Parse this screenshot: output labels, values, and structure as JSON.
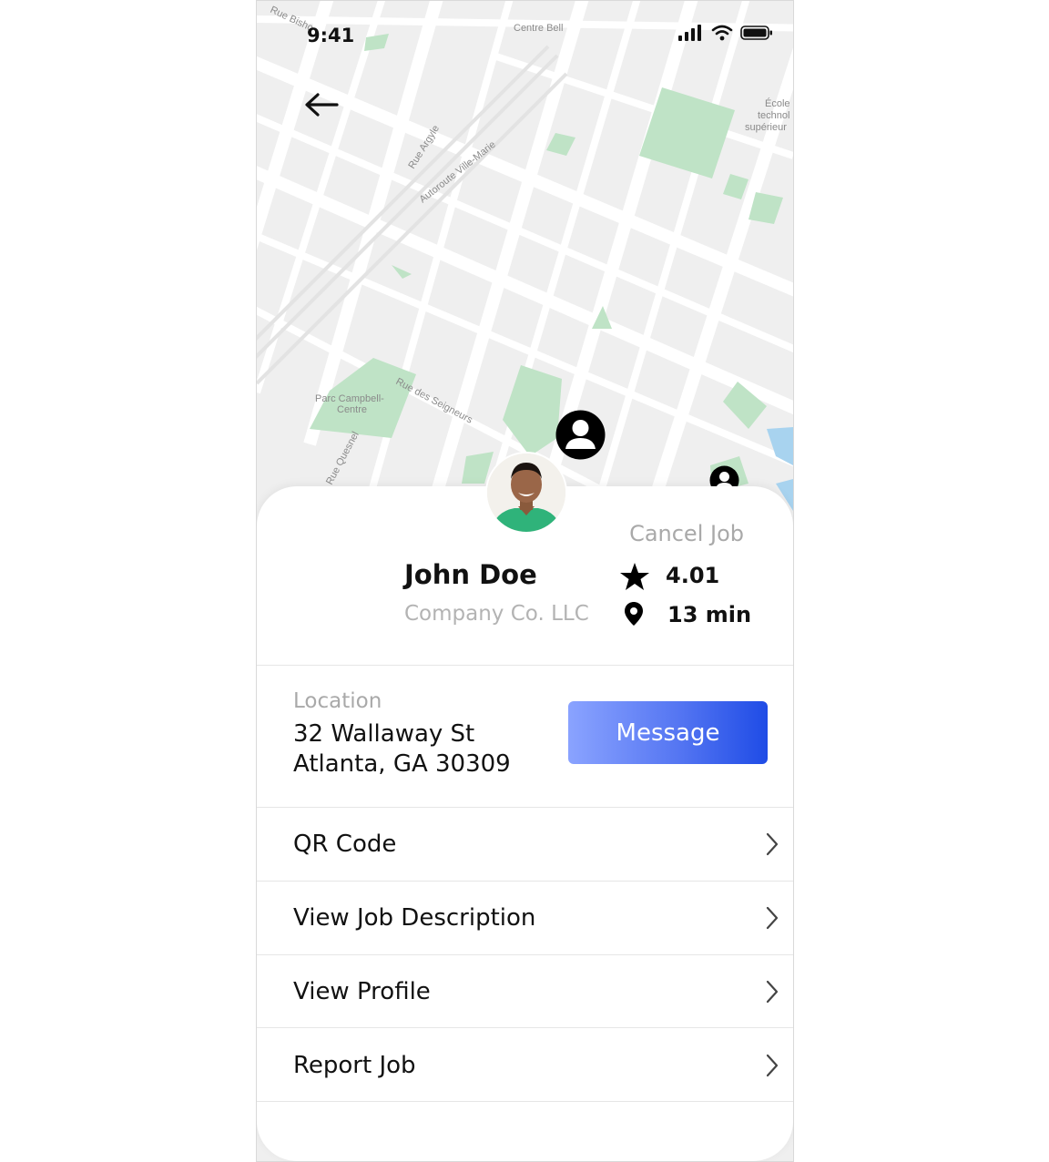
{
  "status_bar": {
    "time": "9:41"
  },
  "map": {
    "labels": {
      "centre_bell": "Centre Bell",
      "rue_bishop": "Rue Bisho",
      "ecole_line1": "École",
      "ecole_line2": "technol",
      "ecole_line3": "supérieur",
      "rue_argyle": "Rue Argyle",
      "autoroute": "Autoroute Ville-Marie",
      "parc_line1": "Parc Campbell-",
      "parc_line2": "Centre",
      "rue_seigneurs": "Rue des Seigneurs",
      "rue_quesnel": "Rue Quesnel"
    }
  },
  "worker": {
    "name": "John Doe",
    "company": "Company Co. LLC",
    "rating": "4.01",
    "eta": "13 min"
  },
  "actions": {
    "cancel_label": "Cancel Job",
    "message_label": "Message"
  },
  "location": {
    "label": "Location",
    "line1": "32 Wallaway St",
    "line2": "Atlanta, GA 30309"
  },
  "menu": [
    {
      "label": "QR Code"
    },
    {
      "label": "View Job Description"
    },
    {
      "label": "View Profile"
    },
    {
      "label": "Report Job"
    }
  ],
  "colors": {
    "map_bg": "#efefef",
    "park": "#bfe3c6",
    "button_gradient_start": "#8aa3ff",
    "button_gradient_end": "#1f4ce6"
  }
}
